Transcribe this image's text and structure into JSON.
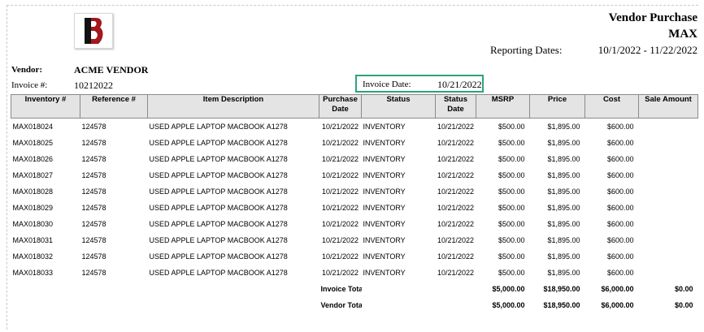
{
  "header": {
    "title_line1": "Vendor Purchase",
    "title_line2": "MAX",
    "reporting_label": "Reporting Dates:",
    "reporting_value": "10/1/2022 - 11/22/2022"
  },
  "vendor": {
    "label": "Vendor:",
    "value": "ACME VENDOR",
    "invoice_label": "Invoice #:",
    "invoice_value": "10212022",
    "invoice_date_label": "Invoice Date:",
    "invoice_date_value": "10/21/2022"
  },
  "table": {
    "columns": [
      "Inventory #",
      "Reference #",
      "Item Description",
      "Purchase Date",
      "Status",
      "Status Date",
      "MSRP",
      "Price",
      "Cost",
      "Sale Amount"
    ],
    "rows": [
      [
        "MAX018024",
        "124578",
        "USED APPLE LAPTOP MACBOOK A1278",
        "10/21/2022",
        "INVENTORY",
        "10/21/2022",
        "$500.00",
        "$1,895.00",
        "$600.00",
        ""
      ],
      [
        "MAX018025",
        "124578",
        "USED APPLE LAPTOP MACBOOK A1278",
        "10/21/2022",
        "INVENTORY",
        "10/21/2022",
        "$500.00",
        "$1,895.00",
        "$600.00",
        ""
      ],
      [
        "MAX018026",
        "124578",
        "USED APPLE LAPTOP MACBOOK A1278",
        "10/21/2022",
        "INVENTORY",
        "10/21/2022",
        "$500.00",
        "$1,895.00",
        "$600.00",
        ""
      ],
      [
        "MAX018027",
        "124578",
        "USED APPLE LAPTOP MACBOOK A1278",
        "10/21/2022",
        "INVENTORY",
        "10/21/2022",
        "$500.00",
        "$1,895.00",
        "$600.00",
        ""
      ],
      [
        "MAX018028",
        "124578",
        "USED APPLE LAPTOP MACBOOK A1278",
        "10/21/2022",
        "INVENTORY",
        "10/21/2022",
        "$500.00",
        "$1,895.00",
        "$600.00",
        ""
      ],
      [
        "MAX018029",
        "124578",
        "USED APPLE LAPTOP MACBOOK A1278",
        "10/21/2022",
        "INVENTORY",
        "10/21/2022",
        "$500.00",
        "$1,895.00",
        "$600.00",
        ""
      ],
      [
        "MAX018030",
        "124578",
        "USED APPLE LAPTOP MACBOOK A1278",
        "10/21/2022",
        "INVENTORY",
        "10/21/2022",
        "$500.00",
        "$1,895.00",
        "$600.00",
        ""
      ],
      [
        "MAX018031",
        "124578",
        "USED APPLE LAPTOP MACBOOK A1278",
        "10/21/2022",
        "INVENTORY",
        "10/21/2022",
        "$500.00",
        "$1,895.00",
        "$600.00",
        ""
      ],
      [
        "MAX018032",
        "124578",
        "USED APPLE LAPTOP MACBOOK A1278",
        "10/21/2022",
        "INVENTORY",
        "10/21/2022",
        "$500.00",
        "$1,895.00",
        "$600.00",
        ""
      ],
      [
        "MAX018033",
        "124578",
        "USED APPLE LAPTOP MACBOOK A1278",
        "10/21/2022",
        "INVENTORY",
        "10/21/2022",
        "$500.00",
        "$1,895.00",
        "$600.00",
        ""
      ]
    ],
    "totals": [
      {
        "label": "Invoice Total:",
        "msrp": "$5,000.00",
        "price": "$18,950.00",
        "cost": "$6,000.00",
        "sale": "$0.00"
      },
      {
        "label": "Vendor Total:",
        "msrp": "$5,000.00",
        "price": "$18,950.00",
        "cost": "$6,000.00",
        "sale": "$0.00"
      }
    ]
  },
  "logo": {
    "icon": "b-logo-icon",
    "colors": {
      "black": "#111111",
      "red": "#a3171d"
    }
  },
  "colors": {
    "highlight_border": "#2aa57a",
    "header_bg": "#e4e4e4"
  }
}
